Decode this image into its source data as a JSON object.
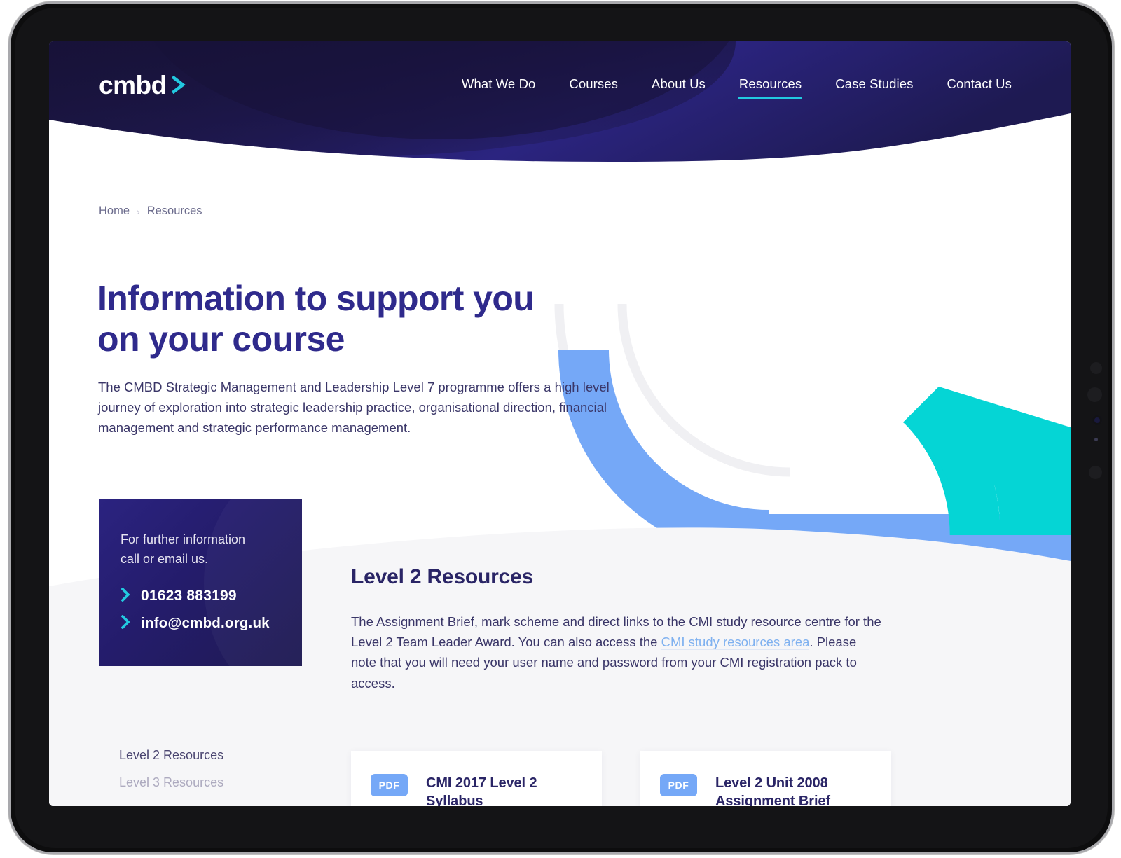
{
  "brand": {
    "logo_text": "cmbd",
    "logo_icon": "chevron-right-icon",
    "accent_cyan": "#22c9e0",
    "accent_blue": "#75a8f7",
    "primary_navy": "#2a2566"
  },
  "header": {
    "nav": [
      {
        "label": "What We Do",
        "active": false
      },
      {
        "label": "Courses",
        "active": false
      },
      {
        "label": "About Us",
        "active": false
      },
      {
        "label": "Resources",
        "active": true
      },
      {
        "label": "Case Studies",
        "active": false
      },
      {
        "label": "Contact Us",
        "active": false
      }
    ]
  },
  "breadcrumb": {
    "home": "Home",
    "separator": "›",
    "current": "Resources"
  },
  "hero": {
    "title_line1": "Information to support you",
    "title_line2": "on your course",
    "body": "The CMBD Strategic Management and Leadership Level 7 programme offers a high level journey of exploration into strategic leadership practice, organisational direction, financial management and strategic performance management."
  },
  "contact_card": {
    "lead": "For further information call or email us.",
    "phone": "01623 883199",
    "email": "info@cmbd.org.uk",
    "bullet_icon": "chevron-right-icon"
  },
  "sub_nav": {
    "items": [
      {
        "label": "Level 2 Resources",
        "active": true
      },
      {
        "label": "Level 3 Resources",
        "active": false
      }
    ]
  },
  "main": {
    "section_title": "Level 2 Resources",
    "body_part1": "The Assignment Brief, mark scheme and direct links to the CMI study resource centre for the Level 2 Team Leader Award. You can also access the ",
    "body_link": "CMI study resources area",
    "body_part2": ". Please note that you will need your user name and password from your CMI registration pack to access.",
    "cards": [
      {
        "badge": "PDF",
        "title_line1": "CMI 2017 Level 2",
        "title_line2": "Syllabus"
      },
      {
        "badge": "PDF",
        "title_line1": "Level 2 Unit 2008",
        "title_line2": "Assignment Brief"
      }
    ]
  }
}
